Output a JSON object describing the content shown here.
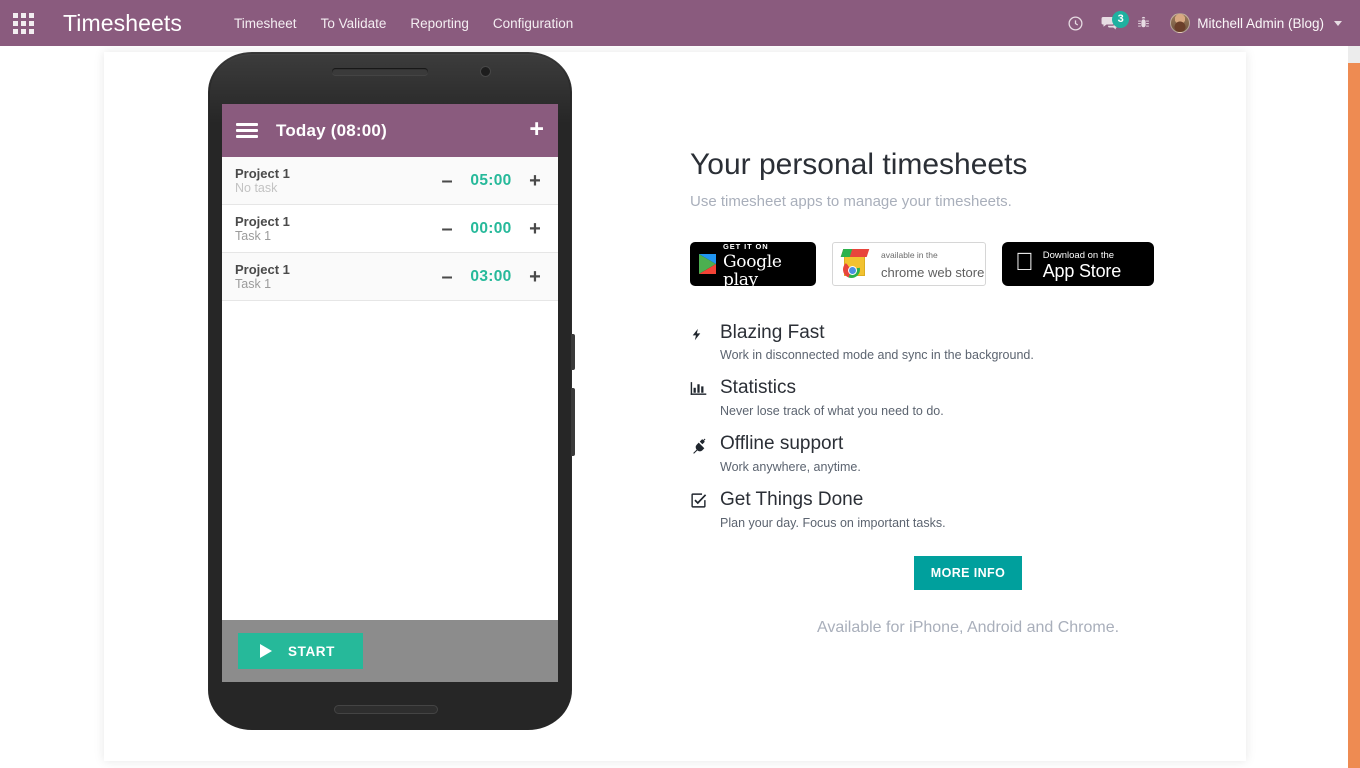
{
  "navbar": {
    "apps_icon": "apps-grid-icon",
    "brand": "Timesheets",
    "menu": [
      {
        "label": "Timesheet"
      },
      {
        "label": "To Validate"
      },
      {
        "label": "Reporting"
      },
      {
        "label": "Configuration"
      }
    ],
    "icons": {
      "activity": "clock-icon",
      "messages": "chat-bubble-icon",
      "messages_count": "3",
      "debug": "bug-icon"
    },
    "user": {
      "name": "Mitchell Admin (Blog)",
      "avatar": "user-avatar",
      "caret": "chevron-down-icon"
    },
    "colors": {
      "background": "#8a5b7e",
      "text": "#ffffff",
      "badge": "#1fb0a0"
    }
  },
  "phone": {
    "app_bar": {
      "menu_icon": "hamburger-icon",
      "title": "Today (08:00)",
      "add_icon": "+"
    },
    "rows": [
      {
        "project": "Project 1",
        "task": "No task",
        "time": "05:00",
        "minus": "–",
        "plus": "+"
      },
      {
        "project": "Project 1",
        "task": "Task 1",
        "time": "00:00",
        "minus": "–",
        "plus": "+"
      },
      {
        "project": "Project 1",
        "task": "Task 1",
        "time": "03:00",
        "minus": "–",
        "plus": "+"
      }
    ],
    "footer": {
      "start_label": "START",
      "play_icon": "play-icon"
    },
    "colors": {
      "app_bar": "#8a5b7e",
      "time": "#26b99a",
      "start": "#26b99a",
      "footer": "#8c8c8c"
    }
  },
  "promo": {
    "heading": "Your personal timesheets",
    "subheading": "Use timesheet apps to manage your timesheets.",
    "badges": [
      {
        "name": "google-play",
        "small": "GET IT ON",
        "big": "Google play"
      },
      {
        "name": "chrome-web-store",
        "small": "available in the",
        "big": "chrome web store"
      },
      {
        "name": "app-store",
        "small": "Download on the",
        "big": "App Store"
      }
    ],
    "features": [
      {
        "icon": "bolt-icon",
        "title": "Blazing Fast",
        "desc": "Work in disconnected mode and sync in the background."
      },
      {
        "icon": "bar-chart-icon",
        "title": "Statistics",
        "desc": "Never lose track of what you need to do."
      },
      {
        "icon": "plug-icon",
        "title": "Offline support",
        "desc": "Work anywhere, anytime."
      },
      {
        "icon": "check-square-icon",
        "title": "Get Things Done",
        "desc": "Plan your day. Focus on important tasks."
      }
    ],
    "more_info": "MORE INFO",
    "availability": "Available for iPhone, Android and Chrome.",
    "colors": {
      "more_info_bg": "#00a09d",
      "muted": "#a9afbb"
    }
  },
  "scrollbar": {
    "thumb_color": "#ee8b52",
    "track_color": "#ececec"
  }
}
